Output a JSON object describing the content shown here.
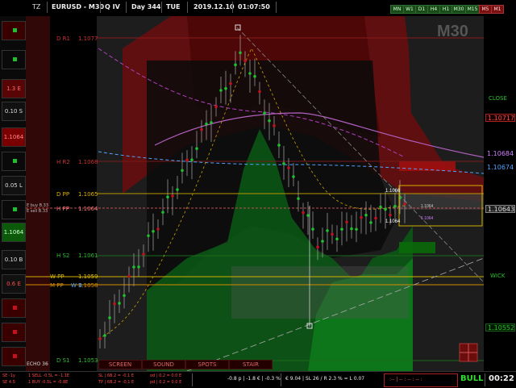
{
  "header": {
    "tz": "TZ",
    "symbol": "EURUSD - M30",
    "quarter": "Q IV",
    "day": "Day 344",
    "weekday": "TUE",
    "date": "2019.12.10",
    "time": "01:07:50",
    "timeframes": [
      "MN",
      "W1",
      "D1",
      "H4",
      "H1",
      "M30",
      "M15",
      "M5",
      "M1"
    ],
    "active_timeframe": "M30"
  },
  "watermark": "M30",
  "left_panel": {
    "items": [
      "1.3 E",
      "0.10 S",
      "1.1064",
      "0.05 L",
      "1.1064",
      "0.10 B",
      "0.6 E"
    ]
  },
  "levels": {
    "d_r1": {
      "label": "D R1",
      "value": "1.1077"
    },
    "h_r2": {
      "label": "H R2",
      "value": "1.1068"
    },
    "d_pp": {
      "label": "D PP",
      "value": "1.1065"
    },
    "h_pp": {
      "label": "H PP",
      "value": "1.1064"
    },
    "h_s2": {
      "label": "H S2",
      "value": "1.1061"
    },
    "w_pp": {
      "label": "W PP",
      "value": "1.1059"
    },
    "m_pp": {
      "label": "M PP",
      "value": "1.1058"
    },
    "d_s1": {
      "label": "D S1",
      "value": "1.1053"
    },
    "wb": "W B",
    "ebuy": "E buy B.33",
    "esell": "E sell B.33",
    "echo": "ECHO 36"
  },
  "price_axis": {
    "close_label": "CLOSE",
    "wick_label": "WICK",
    "prices": [
      "1.10717",
      "1.10684",
      "1.10674",
      "1.10643",
      "1.10552"
    ]
  },
  "chart_labels": {
    "l1": "1.1066",
    "l2": "1.1064",
    "l3": "1.1064",
    "l4": "1.1064"
  },
  "tabs": [
    "SCREEN",
    "SOUND",
    "SPOTS",
    "STAIR"
  ],
  "status": {
    "left1": "SE -1y",
    "left2": "SE 4.5",
    "sell_line": "1 SELL -0.5L = -1.1E",
    "buy_line": "1 BUY  -0.5L = -0.8E",
    "tp_line": "SL | 6B.2 = -0.1 E",
    "tp_line2": "TP | 6B.2 = -0.1 E",
    "od_line": "od | 0.2 = 0.0 E",
    "pd_line": "pd | 0.2 = 0.0 E",
    "pnl": "-0.8 p | -1.8 € | -0.3 %",
    "risk": "€ 9.04 | SL 26 / R 2.3 % = L 0.07",
    "dashes": ":-- | -- : -- : -- :",
    "bias": "BULL",
    "countdown": "00:22"
  },
  "colors": {
    "bull": "#1fbf2f",
    "bear": "#c1121f",
    "accent": "#4fa3ff",
    "gold": "#f2c400"
  }
}
